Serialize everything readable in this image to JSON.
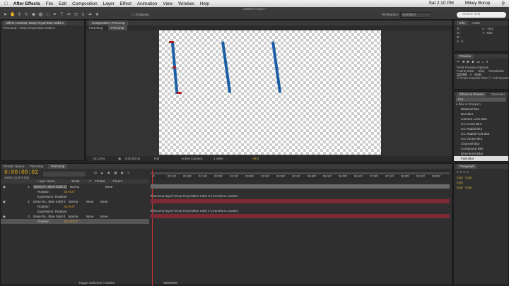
{
  "menu": {
    "app": "After Effects",
    "items": [
      "File",
      "Edit",
      "Composition",
      "Layer",
      "Effect",
      "Animation",
      "View",
      "Window",
      "Help"
    ],
    "time": "Sat 2:10 PM",
    "user": "Mikey Borup"
  },
  "window_title": "Untitled Project *",
  "toolbar": {
    "snapping": "Snapping",
    "workspace_label": "Workspace:",
    "workspace_value": "Standard",
    "search_placeholder": "Search Help"
  },
  "effect_controls": {
    "tab": "Effect Controls: Deep Royal Blue Solid 3",
    "breadcrumb": "PreComp • Deep Royal Blue Solid 3"
  },
  "composition": {
    "tab": "Composition: PreComp",
    "subtabs": [
      "Parenting",
      "PreComp"
    ],
    "zoom": "(51.4%)",
    "timecode": "0:00:00:02",
    "quality": "Full",
    "camera": "Active Camera",
    "view": "1 View",
    "exposure": "+0.0"
  },
  "info": {
    "tabs": [
      "Info",
      "Audio"
    ],
    "r": "R :",
    "g": "G :",
    "b": "B :",
    "a": "A : 0",
    "x": "X : -541",
    "y": "Y : 690"
  },
  "preview": {
    "title": "Preview",
    "ram_options": "RAM Preview Options",
    "frame_rate_label": "Frame Rate",
    "skip_label": "Skip",
    "resolution_label": "Resolution",
    "frame_rate": "(23.98)",
    "skip": "0",
    "resolution": "Auto",
    "from_current": "From Current Time",
    "full_screen": "Full Screen"
  },
  "effects": {
    "tabs": [
      "Effects & Presets",
      "Character"
    ],
    "search": "blur",
    "category": "Blur & Sharpen",
    "items": [
      "Bilateral Blur",
      "Box Blur",
      "Camera Lens Blur",
      "CC Cross Blur",
      "CC Radial Blur",
      "CC Radial Fast Blur",
      "CC Vector Blur",
      "Channel Blur",
      "Compound Blur",
      "Directional Blur",
      "Fast Blur"
    ]
  },
  "paragraph": {
    "title": "Paragraph",
    "px1": "0 px",
    "px2": "0 px",
    "px3": "0 px",
    "px4": "0 px",
    "px5": "0 px"
  },
  "timeline": {
    "tabs": [
      "Render Queue",
      "Parenting",
      "PreComp"
    ],
    "timecode": "0:00:00:02",
    "fps": "00002 (23.976 fps)",
    "columns": [
      "Layer Name",
      "Mode",
      "T",
      "TrkMat",
      "Parent"
    ],
    "ruler": [
      "0f",
      "00:12f",
      "01:00f",
      "01:12f",
      "02:00f",
      "02:12f",
      "03:00f",
      "03:12f",
      "04:00f",
      "04:12f",
      "05:00f",
      "05:12f",
      "06:00f",
      "06:12f",
      "07:00f",
      "07:12f",
      "08:00f",
      "08:12f",
      "09:00f"
    ],
    "layers": [
      {
        "num": "1",
        "name": "[Deep R...Blue Solid 2]",
        "mode": "Norma",
        "trkmat": "",
        "parent": "None",
        "prop": "Rotation",
        "value": "0x+5.0°",
        "expr_label": "",
        "expr": ""
      },
      {
        "num": "2",
        "name": "Deep Ro...Blue Solid 3",
        "mode": "Norma",
        "trkmat": "None",
        "parent": "None",
        "prop": "Expression: Rotation",
        "value": "",
        "expr_label": "",
        "expr": "thisComp.layer(\"Deep Royal Blue Solid 3\").transform.rotation"
      },
      {
        "num": "3",
        "name": "Deep Ro...Blue Solid 4",
        "mode": "Norma",
        "trkmat": "None",
        "parent": "None",
        "prop": "Expression: Rotation",
        "value": "",
        "expr_label": "",
        "expr": "thisComp.layer(\"Deep Royal Blue Solid 4\").transform.rotation"
      }
    ],
    "rotation_label": "Rotation",
    "rot2": "0x+5.0°",
    "rot3": "0x+5.0°",
    "rot4": "0x+112.0°",
    "toggle": "Toggle Switches / Modes"
  }
}
